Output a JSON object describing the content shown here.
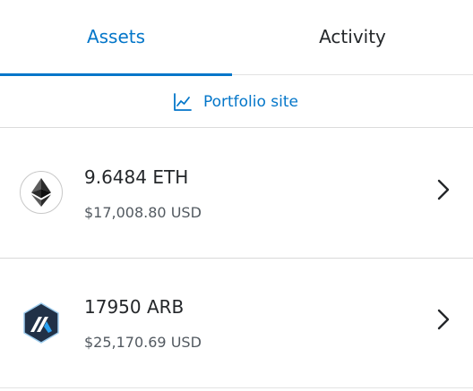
{
  "tabs": {
    "assets_label": "Assets",
    "activity_label": "Activity",
    "active": "Assets"
  },
  "portfolio": {
    "label": "Portfolio site",
    "icon": "chart-line-icon"
  },
  "assets": [
    {
      "amount": "9.6484 ETH",
      "fiat": "$17,008.80 USD",
      "icon": "ethereum-icon"
    },
    {
      "amount": "17950 ARB",
      "fiat": "$25,170.69 USD",
      "icon": "arbitrum-icon"
    }
  ],
  "colors": {
    "accent": "#0376c9",
    "text_primary": "#24272a",
    "text_secondary": "#535a61",
    "divider": "#dcdcdc",
    "arbitrum_bg": "#213147",
    "arbitrum_blue": "#28a0f0"
  }
}
